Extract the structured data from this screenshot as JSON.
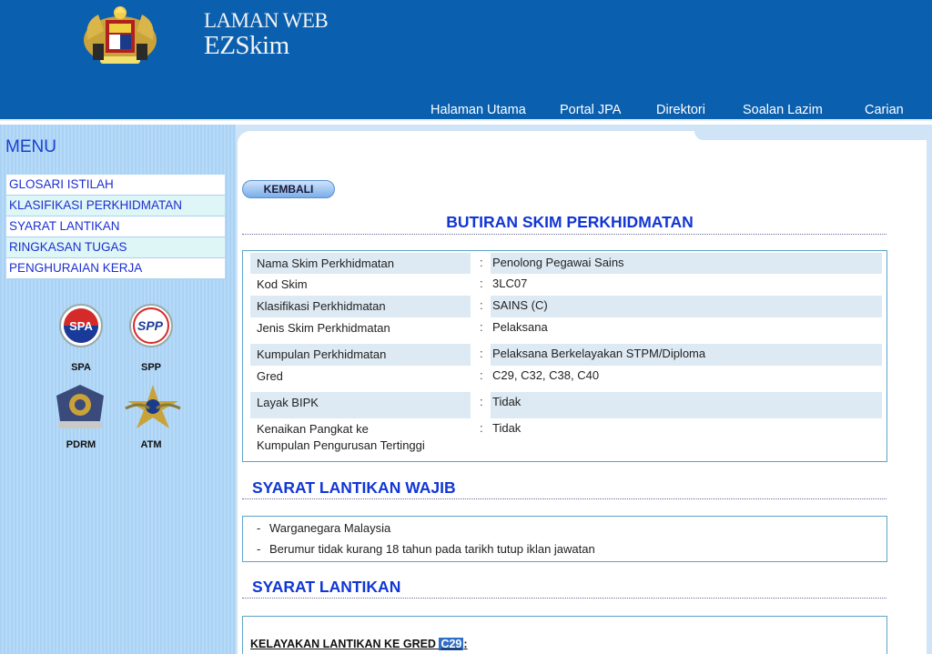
{
  "header": {
    "title_line1": "LAMAN WEB",
    "title_line2": "EZSkim",
    "nav": [
      "Halaman Utama",
      "Portal JPA",
      "Direktori",
      "Soalan Lazim",
      "Carian"
    ]
  },
  "sidebar": {
    "menu_title": "MENU",
    "items": [
      "GLOSARI ISTILAH",
      "KLASIFIKASI PERKHIDMATAN",
      "SYARAT LANTIKAN",
      "RINGKASAN TUGAS",
      "PENGHURAIAN KERJA"
    ],
    "logos": [
      {
        "label": "SPA",
        "icon": "spa-logo-icon"
      },
      {
        "label": "SPP",
        "icon": "spp-logo-icon"
      },
      {
        "label": "PDRM",
        "icon": "pdrm-logo-icon"
      },
      {
        "label": "ATM",
        "icon": "atm-logo-icon"
      }
    ]
  },
  "main": {
    "back_label": "KEMBALI",
    "heading": "BUTIRAN SKIM PERKHIDMATAN",
    "separator": ":",
    "details": [
      {
        "label": "Nama Skim Perkhidmatan",
        "value": "Penolong Pegawai Sains"
      },
      {
        "label": "Kod Skim",
        "value": "3LC07"
      },
      {
        "label": "Klasifikasi Perkhidmatan",
        "value": "SAINS (C)"
      },
      {
        "label": "Jenis Skim Perkhidmatan",
        "value": "Pelaksana"
      },
      {
        "label": "Kumpulan Perkhidmatan",
        "value": "Pelaksana Berkelayakan STPM/Diploma"
      },
      {
        "label": "Gred",
        "value": "C29, C32, C38, C40"
      },
      {
        "label": "Layak BIPK",
        "value": "Tidak"
      },
      {
        "label_line1": "Kenaikan Pangkat ke",
        "label_line2": "Kumpulan Pengurusan Tertinggi",
        "value": "Tidak"
      }
    ],
    "wajib_heading": "SYARAT LANTIKAN WAJIB",
    "wajib_items": [
      "Warganegara Malaysia",
      "Berumur tidak kurang 18 tahun pada tarikh tutup iklan jawatan"
    ],
    "lantikan_heading": "SYARAT LANTIKAN",
    "kelayakan_prefix": "KELAYAKAN LANTIKAN KE GRED",
    "kelayakan_gred": "C29",
    "kelayakan_suffix": ":"
  },
  "colors": {
    "header_bg": "#0a5fae",
    "heading_blue": "#1136d4",
    "menu_link": "#1c2fd0",
    "highlight": "#2f6fc8"
  }
}
